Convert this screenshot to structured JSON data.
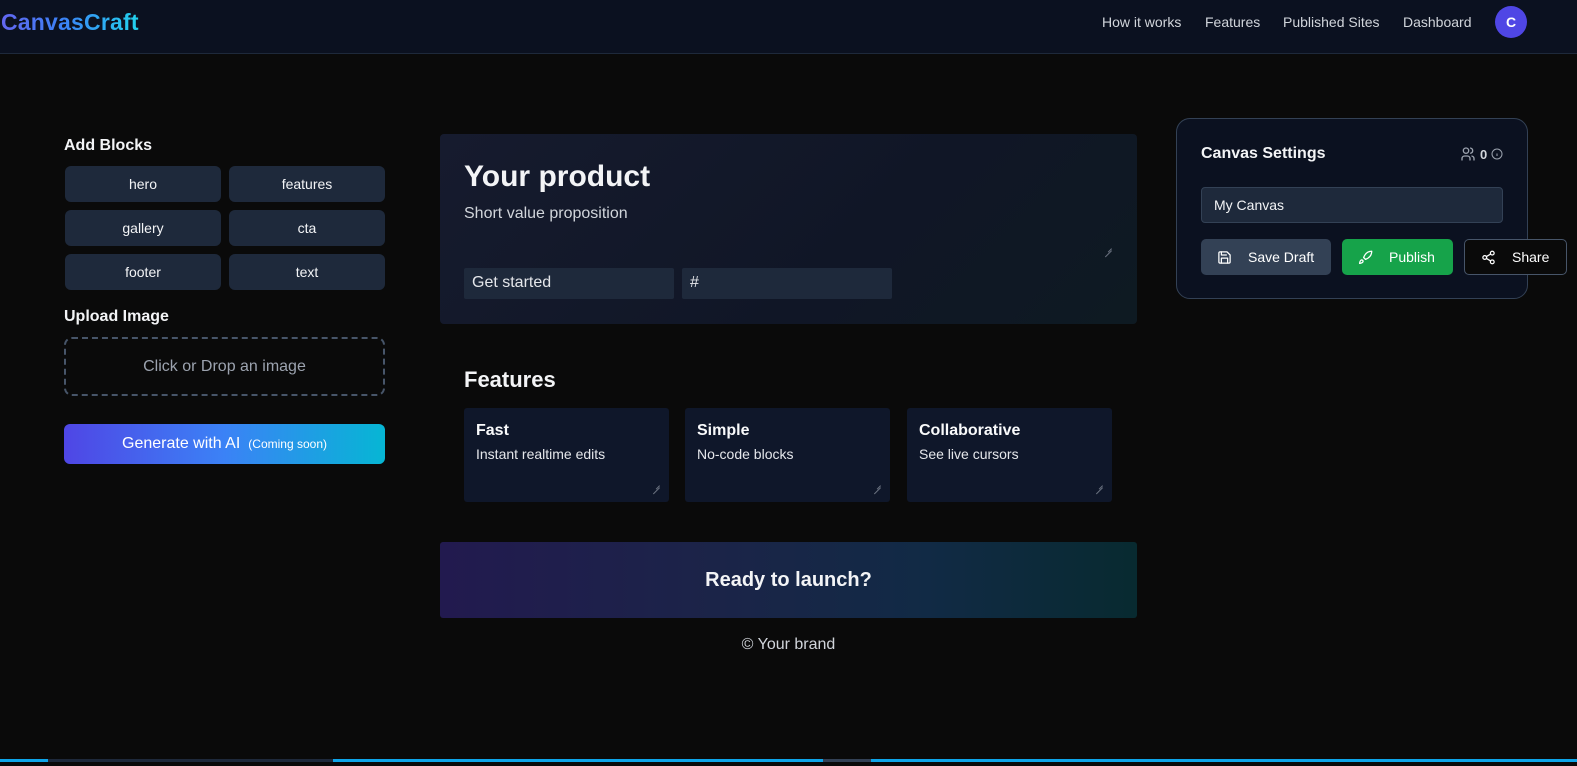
{
  "app": {
    "brand": "CanvasCraft",
    "avatar_initial": "C"
  },
  "nav": {
    "how_it_works": "How it works",
    "features": "Features",
    "published_sites": "Published Sites",
    "dashboard": "Dashboard"
  },
  "sidebar": {
    "add_blocks_title": "Add Blocks",
    "blocks": [
      "hero",
      "features",
      "gallery",
      "cta",
      "footer",
      "text"
    ],
    "upload_title": "Upload Image",
    "dropzone_text": "Click or Drop an image",
    "generate_label": "Generate with AI",
    "generate_badge": "(Coming soon)"
  },
  "canvas": {
    "hero": {
      "title": "Your product",
      "subtitle": "Short value proposition",
      "button_text": "Get started",
      "button_link": "#"
    },
    "features": {
      "heading": "Features",
      "items": [
        {
          "title": "Fast",
          "desc": "Instant realtime edits"
        },
        {
          "title": "Simple",
          "desc": "No-code blocks"
        },
        {
          "title": "Collaborative",
          "desc": "See live cursors"
        }
      ]
    },
    "cta": {
      "text": "Ready to launch?"
    },
    "footer": {
      "text": "© Your brand"
    }
  },
  "settings": {
    "title": "Canvas Settings",
    "collaborators_count": "0",
    "canvas_name": "My Canvas",
    "save_label": "Save Draft",
    "publish_label": "Publish",
    "share_label": "Share"
  },
  "icons": [
    "users-icon",
    "info-icon",
    "save-icon",
    "rocket-icon",
    "share-icon"
  ],
  "colors": {
    "accent": "#4f46e5",
    "publish": "#16a34a",
    "panel": "#1e293b"
  }
}
